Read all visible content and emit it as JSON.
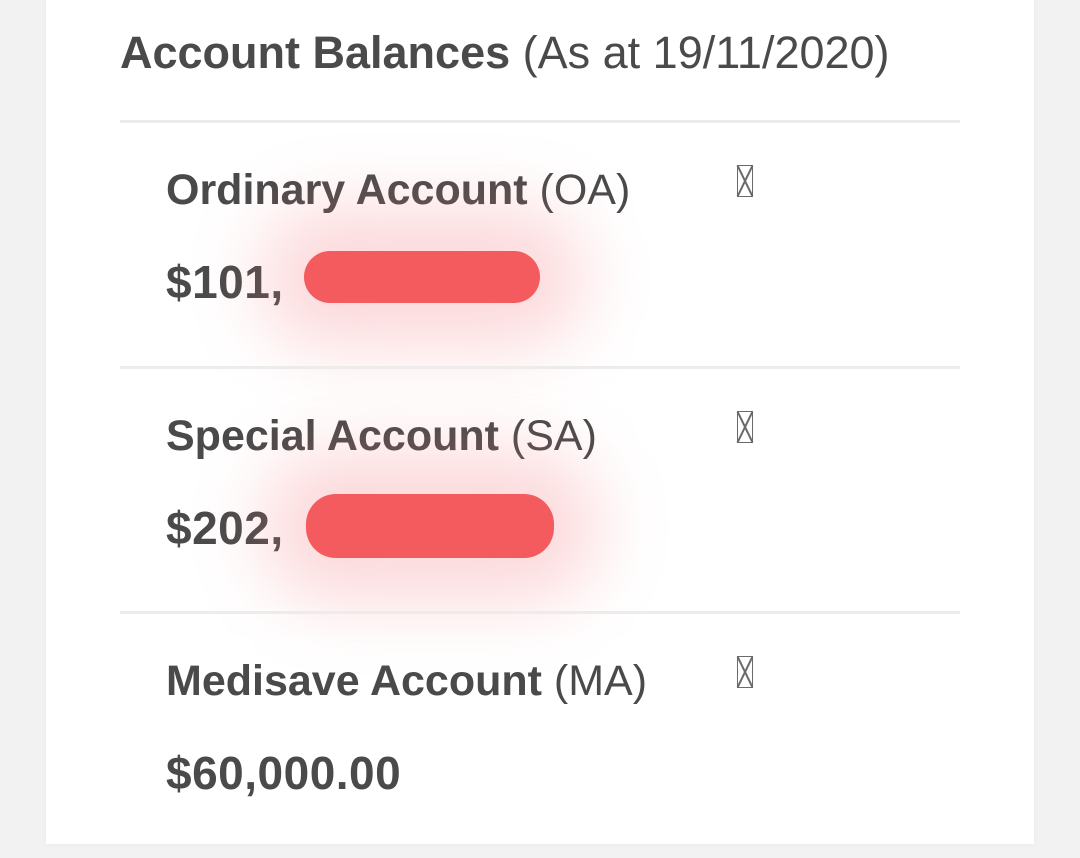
{
  "header": {
    "title_bold": "Account Balances",
    "title_rest": "(As at 19/11/2020)"
  },
  "accounts": [
    {
      "name": "Ordinary Account",
      "code": "(OA)",
      "amount_visible": "$101,",
      "redacted": true,
      "info_icon": "info-icon"
    },
    {
      "name": "Special Account",
      "code": "(SA)",
      "amount_visible": "$202,",
      "redacted": true,
      "info_icon": "info-icon"
    },
    {
      "name": "Medisave Account",
      "code": "(MA)",
      "amount_visible": "$60,000.00",
      "redacted": false,
      "info_icon": "info-icon"
    }
  ],
  "colors": {
    "background": "#f2f2f2",
    "card": "#ffffff",
    "text": "#4a4a4a",
    "divider": "#ececec",
    "redaction": "#f45b5e"
  }
}
